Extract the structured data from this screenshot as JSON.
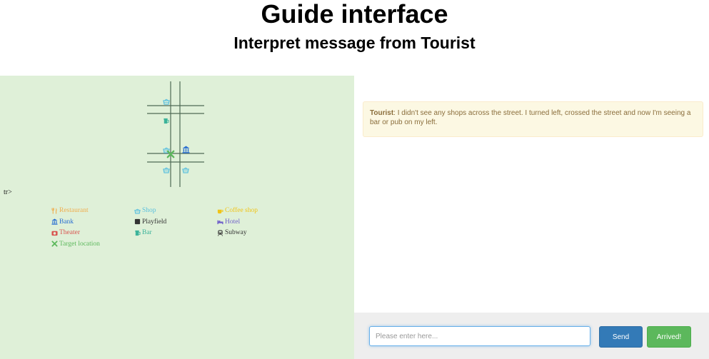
{
  "header": {
    "title": "Guide interface",
    "subtitle": "Interpret message from Tourist"
  },
  "map": {
    "stray_text": "tr>",
    "colors": {
      "background": "#dff0d8",
      "street": "#4f6a55",
      "shop": "#5bc0de",
      "bar": "#3cb39a",
      "bank": "#2a6fd1",
      "target": "#5cb85c"
    },
    "markers": [
      {
        "type": "shop",
        "icon": "basket-icon"
      },
      {
        "type": "bar",
        "icon": "beer-icon"
      },
      {
        "type": "shop",
        "icon": "basket-icon"
      },
      {
        "type": "bank",
        "icon": "bank-icon"
      },
      {
        "type": "target",
        "icon": "target-x-icon"
      },
      {
        "type": "shop",
        "icon": "basket-icon"
      },
      {
        "type": "shop",
        "icon": "basket-icon"
      }
    ]
  },
  "legend": {
    "items": [
      {
        "label": "Restaurant",
        "icon": "cutlery-icon",
        "color": "#f0ad4e"
      },
      {
        "label": "Shop",
        "icon": "basket-icon",
        "color": "#5bc0de"
      },
      {
        "label": "Coffee shop",
        "icon": "coffee-icon",
        "color": "#f0c419"
      },
      {
        "label": "Bank",
        "icon": "bank-icon",
        "color": "#2a6fd1"
      },
      {
        "label": "Playfield",
        "icon": "square-icon",
        "color": "#333333"
      },
      {
        "label": "Hotel",
        "icon": "bed-icon",
        "color": "#6f5fc9"
      },
      {
        "label": "Theater",
        "icon": "camera-icon",
        "color": "#d9534f"
      },
      {
        "label": "Bar",
        "icon": "beer-icon",
        "color": "#3cb39a"
      },
      {
        "label": "Subway",
        "icon": "train-icon",
        "color": "#333333"
      },
      {
        "label": "Target location",
        "icon": "target-x-icon",
        "color": "#5cb85c"
      }
    ]
  },
  "chat": {
    "message": {
      "sender": "Tourist",
      "text": ": I didn't see any shops across the street. I turned left, crossed the street and now I'm seeing a bar or pub on my left."
    },
    "input_placeholder": "Please enter here...",
    "send_label": "Send",
    "arrived_label": "Arrived!"
  }
}
